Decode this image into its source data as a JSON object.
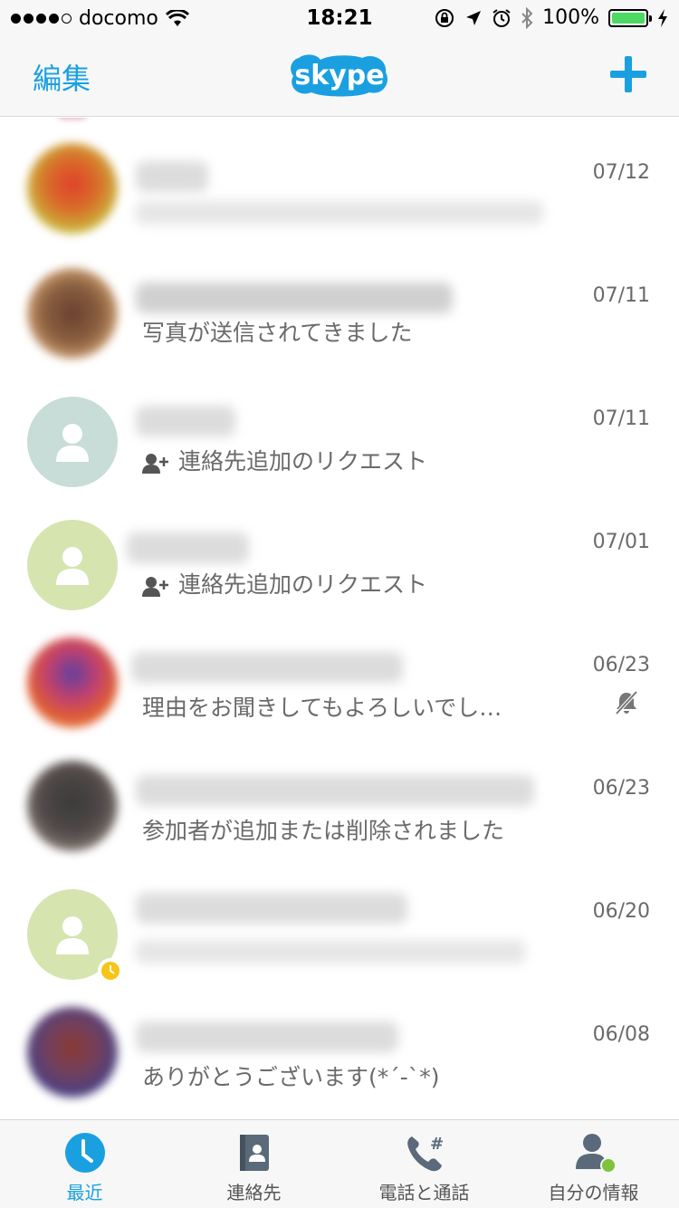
{
  "status_bar": {
    "carrier": "docomo",
    "time": "18:21",
    "battery": "100%"
  },
  "nav": {
    "edit_label": "編集",
    "logo_text": "skype"
  },
  "conversations": [
    {
      "date": "07/12",
      "preview": ""
    },
    {
      "date": "07/11",
      "preview": "写真が送信されてきました"
    },
    {
      "date": "07/11",
      "preview": "連絡先追加のリクエスト"
    },
    {
      "date": "07/01",
      "preview": "連絡先追加のリクエスト"
    },
    {
      "date": "06/23",
      "preview": "理由をお聞きしてもよろしいでし…"
    },
    {
      "date": "06/23",
      "preview": "参加者が追加または削除されました"
    },
    {
      "date": "06/20",
      "preview": ""
    },
    {
      "date": "06/08",
      "preview": "ありがとうございます(*´-`*)"
    }
  ],
  "tabs": [
    {
      "label": "最近"
    },
    {
      "label": "連絡先"
    },
    {
      "label": "電話と通話"
    },
    {
      "label": "自分の情報"
    }
  ],
  "colors": {
    "accent": "#1aa0e0",
    "default_avatar_gray": "#c8dcd8",
    "default_avatar_green": "#d6e4b0",
    "online_green": "#7cc43a",
    "away_yellow": "#f5c518"
  }
}
